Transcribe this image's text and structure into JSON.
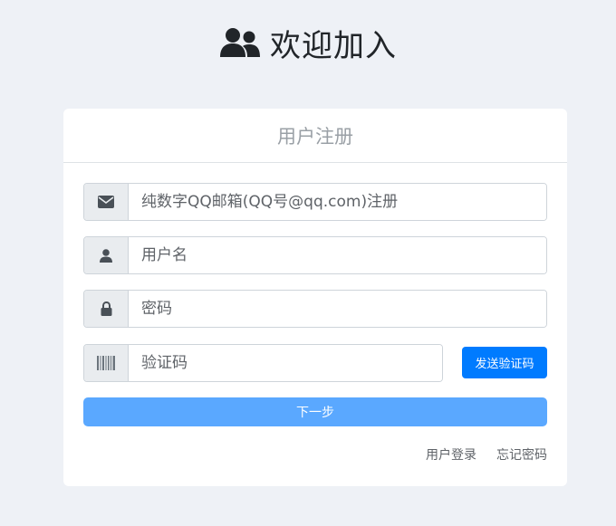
{
  "header": {
    "title": "欢迎加入",
    "icon": "users-icon"
  },
  "card": {
    "title": "用户注册"
  },
  "form": {
    "email": {
      "icon": "envelope-icon",
      "placeholder": "纯数字QQ邮箱(QQ号@qq.com)注册",
      "value": ""
    },
    "username": {
      "icon": "user-icon",
      "placeholder": "用户名",
      "value": ""
    },
    "password": {
      "icon": "lock-icon",
      "placeholder": "密码",
      "value": ""
    },
    "code": {
      "icon": "barcode-icon",
      "placeholder": "验证码",
      "value": ""
    },
    "send_code_label": "发送验证码",
    "next_label": "下一步"
  },
  "links": {
    "login": "用户登录",
    "forgot": "忘记密码"
  },
  "colors": {
    "background": "#eef1f6",
    "primary": "#007bff",
    "next_button": "#5aa8ff"
  }
}
